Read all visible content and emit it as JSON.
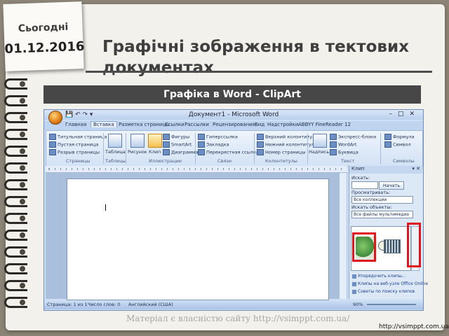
{
  "sticky": {
    "label": "Сьогодні",
    "date": "01.12.2016"
  },
  "slide_title": "Графічні зображення в тектових документах",
  "banner": "Графіка в Word - ClipArt",
  "word": {
    "window_title": "Документ1 - Microsoft Word",
    "tabs": [
      "Главная",
      "Вставка",
      "Разметка страницы",
      "Ссылки",
      "Рассылки",
      "Рецензирование",
      "Вид",
      "Надстройки",
      "ABBYY FineReader 12"
    ],
    "active_tab": "Вставка",
    "ribbon": {
      "pages": [
        "Титульная страница",
        "Пустая страница",
        "Разрыв страницы"
      ],
      "table": "Таблица",
      "picture": "Рисунок",
      "clip": "Клип",
      "illus": [
        "Фигуры",
        "SmartArt",
        "Диаграмма"
      ],
      "links": [
        "Гиперссылка",
        "Закладка",
        "Перекрестная ссылка"
      ],
      "hf": [
        "Верхний колонтитул",
        "Нижний колонтитул",
        "Номер страницы"
      ],
      "textbox": "Надпись",
      "text": [
        "Экспресс-блоки",
        "WordArt",
        "Буквица"
      ],
      "symbols": [
        "Формула",
        "Символ"
      ],
      "groups": [
        "Страницы",
        "Таблицы",
        "Иллюстрации",
        "Связи",
        "Колонтитулы",
        "Текст",
        "Символы"
      ]
    },
    "clip_pane": {
      "title": "Клип",
      "search_label": "Искать:",
      "search_button": "Начать",
      "scope_label": "Просматривать:",
      "scope_value": "Все коллекции",
      "types_label": "Искать объекты:",
      "types_value": "Все файлы мультимедиа",
      "links": [
        "Упорядочить клипы...",
        "Клипы на веб-узле Office Online",
        "Советы по поиску клипов"
      ]
    },
    "status": {
      "page": "Страница: 1 из 1",
      "words": "Число слов: 0",
      "lang": "Английский (США)",
      "zoom": "90%"
    }
  },
  "footer": "Матеріал є власністю сайту http://vsimppt.com.ua/",
  "url": "http://vsimppt.com.ua/"
}
